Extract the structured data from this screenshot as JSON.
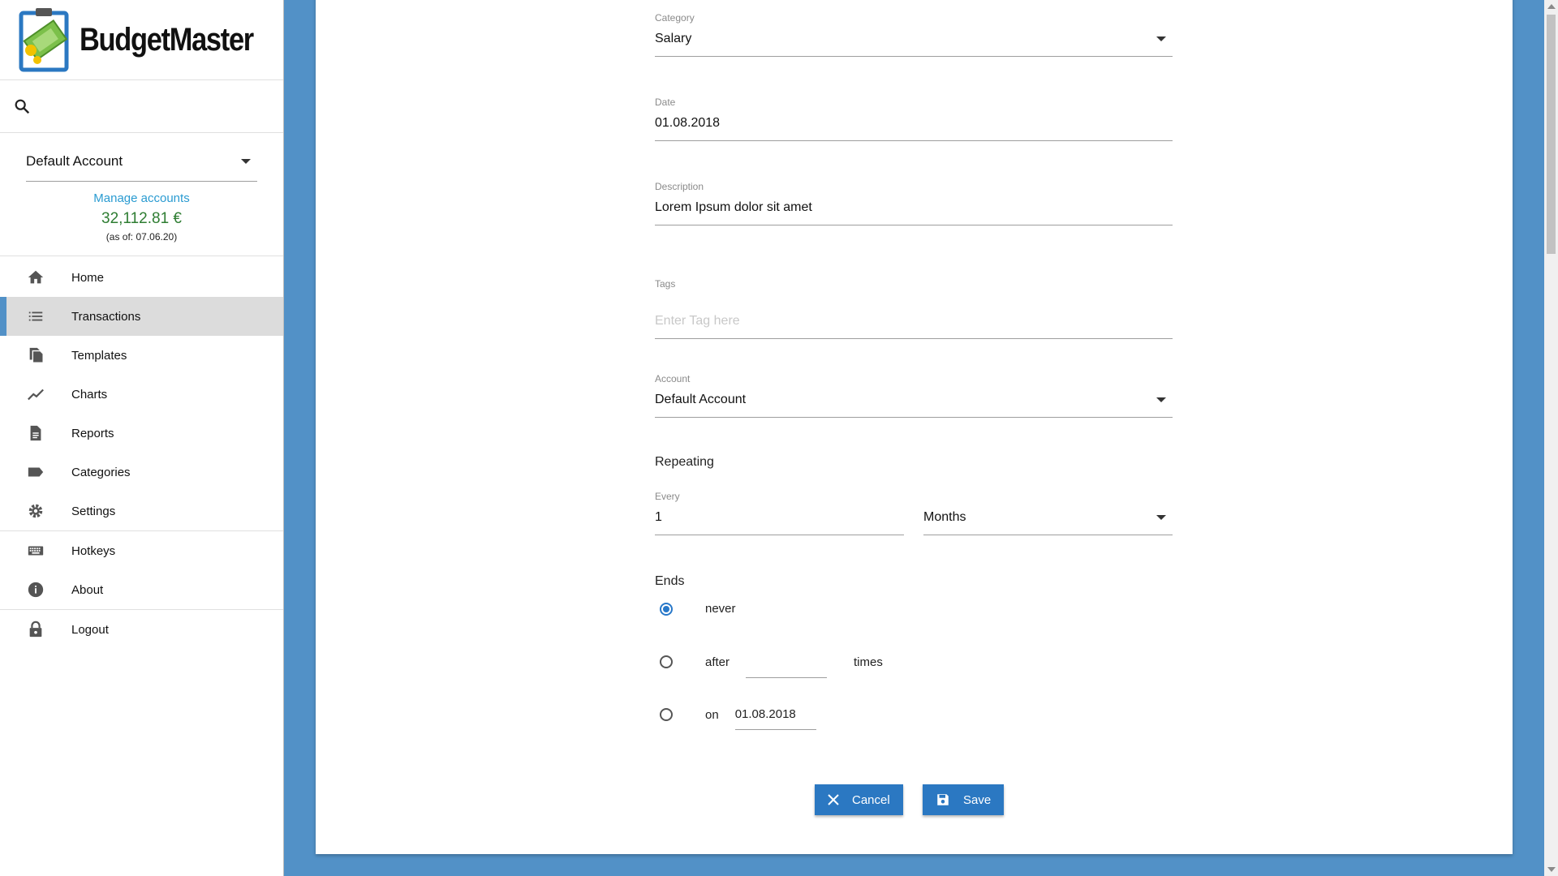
{
  "app": {
    "name": "BudgetMaster"
  },
  "sidebar": {
    "account_selected": "Default Account",
    "manage_accounts": "Manage accounts",
    "balance": "32,112.81 €",
    "as_of": "(as of: 07.06.20)",
    "items": [
      {
        "label": "Home",
        "icon": "home-icon"
      },
      {
        "label": "Transactions",
        "icon": "list-icon",
        "active": true
      },
      {
        "label": "Templates",
        "icon": "copy-icon"
      },
      {
        "label": "Charts",
        "icon": "chart-line-icon"
      },
      {
        "label": "Reports",
        "icon": "document-icon"
      },
      {
        "label": "Categories",
        "icon": "tag-icon"
      },
      {
        "label": "Settings",
        "icon": "gear-icon"
      },
      {
        "label": "Hotkeys",
        "icon": "keyboard-icon"
      },
      {
        "label": "About",
        "icon": "info-icon"
      },
      {
        "label": "Logout",
        "icon": "lock-icon"
      }
    ]
  },
  "form": {
    "category": {
      "label": "Category",
      "value": "Salary"
    },
    "date": {
      "label": "Date",
      "value": "01.08.2018"
    },
    "description": {
      "label": "Description",
      "value": "Lorem Ipsum dolor sit amet"
    },
    "tags": {
      "label": "Tags",
      "placeholder": "Enter Tag here"
    },
    "account": {
      "label": "Account",
      "value": "Default Account"
    },
    "repeating": {
      "title": "Repeating",
      "every_label": "Every",
      "every_value": "1",
      "unit": "Months"
    },
    "ends": {
      "title": "Ends",
      "never": "never",
      "after": "after",
      "times": "times",
      "on": "on",
      "on_date": "01.08.2018",
      "selected": "never"
    },
    "cancel": "Cancel",
    "save": "Save"
  },
  "colors": {
    "background": "#5291c7",
    "accent": "#2b78c2",
    "balance": "#2e7d32",
    "link": "#2a9bd1"
  }
}
